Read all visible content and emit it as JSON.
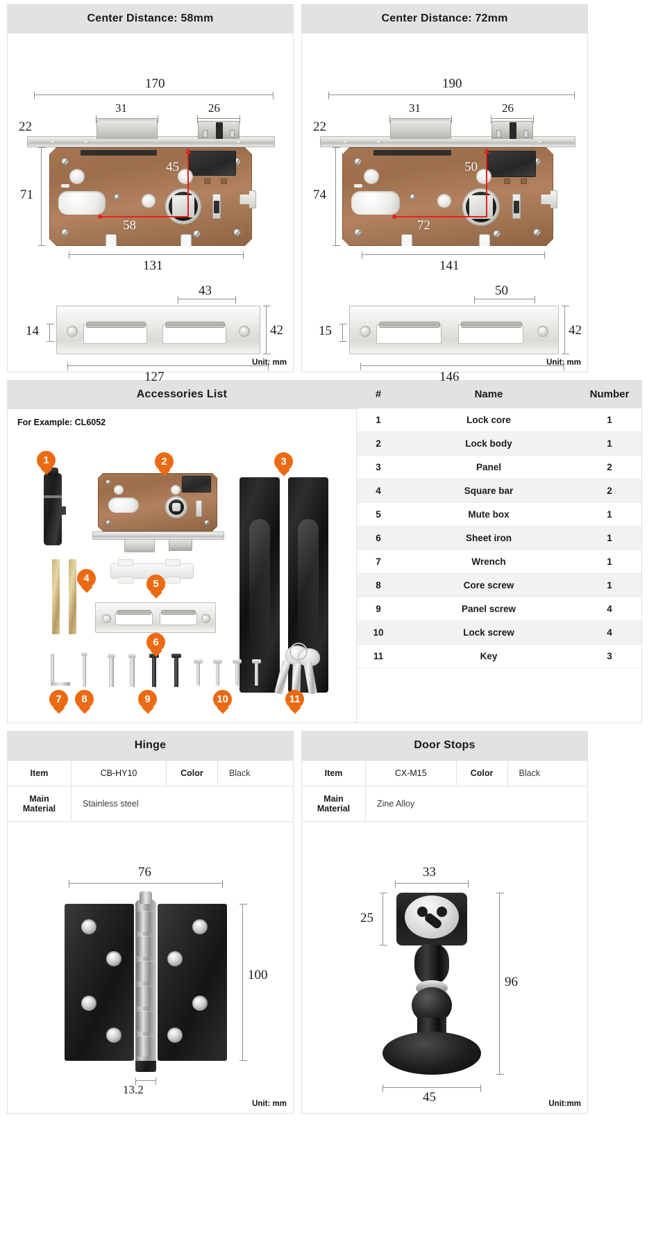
{
  "panel_58": {
    "title": "Center Distance: 58mm",
    "unit": "Unit: mm",
    "lock_body": {
      "overall_length": "170",
      "latch_width": "31",
      "deadbolt_width": "26",
      "faceplate_thickness": "22",
      "case_height": "71",
      "case_length": "131",
      "center_height": "45",
      "center_distance": "58"
    },
    "strike_plate": {
      "slot_width": "43",
      "edge_offset": "14",
      "height": "42",
      "length": "127"
    }
  },
  "panel_72": {
    "title": "Center Distance: 72mm",
    "unit": "Unit: mm",
    "lock_body": {
      "overall_length": "190",
      "latch_width": "31",
      "deadbolt_width": "26",
      "faceplate_thickness": "22",
      "case_height": "74",
      "case_length": "141",
      "center_height": "50",
      "center_distance": "72"
    },
    "strike_plate": {
      "slot_width": "50",
      "edge_offset": "15",
      "height": "42",
      "length": "146"
    }
  },
  "accessories": {
    "title": "Accessories List",
    "example_label": "For Example: CL6052",
    "markers": [
      "1",
      "2",
      "3",
      "4",
      "5",
      "6",
      "7",
      "8",
      "9",
      "10",
      "11"
    ],
    "columns": {
      "id": "#",
      "name": "Name",
      "number": "Number"
    },
    "rows": [
      {
        "id": "1",
        "name": "Lock core",
        "number": "1"
      },
      {
        "id": "2",
        "name": "Lock body",
        "number": "1"
      },
      {
        "id": "3",
        "name": "Panel",
        "number": "2"
      },
      {
        "id": "4",
        "name": "Square bar",
        "number": "2"
      },
      {
        "id": "5",
        "name": "Mute box",
        "number": "1"
      },
      {
        "id": "6",
        "name": "Sheet iron",
        "number": "1"
      },
      {
        "id": "7",
        "name": "Wrench",
        "number": "1"
      },
      {
        "id": "8",
        "name": "Core screw",
        "number": "1"
      },
      {
        "id": "9",
        "name": "Panel screw",
        "number": "4"
      },
      {
        "id": "10",
        "name": "Lock screw",
        "number": "4"
      },
      {
        "id": "11",
        "name": "Key",
        "number": "3"
      }
    ]
  },
  "hinge": {
    "title": "Hinge",
    "spec": {
      "item_label": "Item",
      "item_value": "CB-HY10",
      "color_label": "Color",
      "color_value": "Black",
      "material_label": "Main Material",
      "material_value": "Stainless steel"
    },
    "dims": {
      "width": "76",
      "height": "100",
      "thickness": "13.2"
    },
    "unit": "Unit: mm"
  },
  "door_stops": {
    "title": "Door Stops",
    "spec": {
      "item_label": "Item",
      "item_value": "CX-M15",
      "color_label": "Color",
      "color_value": "Black",
      "material_label": "Main Material",
      "material_value": "Zine Alloy"
    },
    "dims": {
      "head_width": "33",
      "head_height": "25",
      "total_height": "96",
      "base_width": "45"
    },
    "unit": "Unit:mm"
  },
  "colors": {
    "header_bg": "#e2e2e2",
    "accent_orange": "#ec6a13",
    "measure_red": "#e8201a",
    "brass": "#a57551"
  }
}
